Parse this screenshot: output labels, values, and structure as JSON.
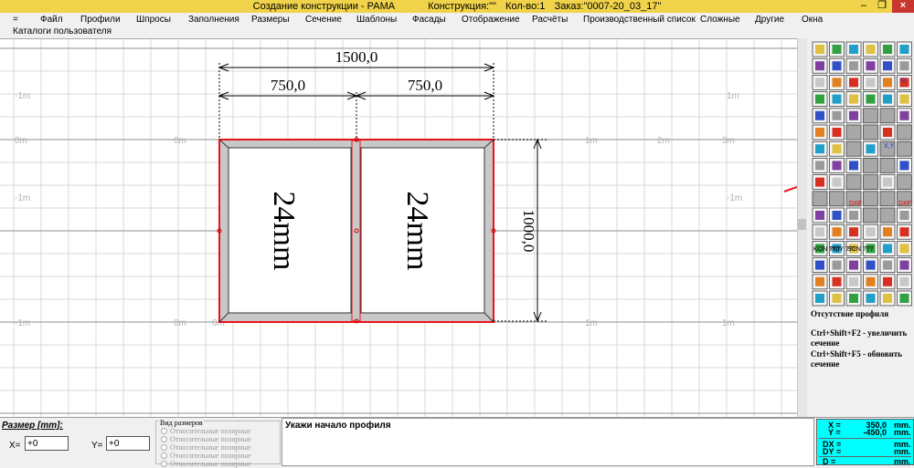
{
  "window": {
    "title": "Создание конструкции - РАМА",
    "construction_label": "Конструкция:\"\"",
    "count_label": "Кол-во:1",
    "order_label": "Заказ:\"0007-20_03_17\""
  },
  "menu": {
    "items": [
      "=",
      "Файл",
      "Профили",
      "Шпросы",
      "Заполнения",
      "Размеры",
      "Сечение",
      "Шаблоны",
      "Фасады",
      "Отображение",
      "Расчёты",
      "Производственный список",
      "Сложные",
      "Другие",
      "Окна"
    ],
    "second_row": "Каталоги пользователя"
  },
  "drawing": {
    "dimensions": {
      "total_width": "1500,0",
      "left_width": "750,0",
      "right_width": "750,0",
      "height": "1000,0"
    },
    "panes": {
      "left_fill": "24mm",
      "right_fill": "24mm"
    },
    "grid_labels": [
      "-1m",
      "0m",
      "-1m",
      "-1m",
      "0m",
      "1m",
      "2m",
      "3m",
      "0m",
      "0m",
      "1m",
      "1m",
      "-1m",
      "1m"
    ],
    "colors": {
      "frame_outline": "#e8141c",
      "frame_fill": "#c8c8c8",
      "grid": "#d9d9d9",
      "grid_major": "#b3b3b3",
      "pointer_line": "#e8141c"
    }
  },
  "tool_panel": {
    "status_title": "Отсутствие профиля",
    "hint_1": "Ctrl+Shift+F2 - увеличить сечение",
    "hint_2": "Ctrl+Shift+F5 - обновить сечение",
    "icons": [
      "profile-icon",
      "impost-icon",
      "sash-icon",
      "glass-icon",
      "cut-icon",
      "shtapik-icon",
      "fill-icon",
      "dimension-icon",
      "calc-icon",
      "section-icon",
      "mirror-icon",
      "dxf-icon",
      "zoom-icon",
      "zoom-in-icon",
      "zoom-out-icon",
      "undo-icon",
      "check-icon",
      "delete-icon",
      "help-icon"
    ],
    "text_tools": [
      "KON\n???",
      "IX|IY\n???",
      "SCN\n???"
    ],
    "dxf_labels": [
      "DXF",
      "DXF"
    ],
    "small_tool_texts": [
      "IX",
      "X,Y"
    ]
  },
  "bottom": {
    "size_label": "Размер [mm]:",
    "x_label": "X=",
    "x_value": "+0",
    "y_label": "Y=",
    "y_value": "+0",
    "view_group_label": "Вид размеров",
    "view_options": [
      "Относительные полярные",
      "Относительные полярные",
      "Относительные полярные",
      "Относительные полярные",
      "Относительные полярные"
    ],
    "status_message": "Укажи начало профиля"
  },
  "coords": {
    "x_label": "X =",
    "x_value": "350,0",
    "y_label": "Y =",
    "y_value": "-450,0",
    "unit": "mm.",
    "dx_label": "DX =",
    "dy_label": "DY =",
    "d_label": "D ="
  }
}
